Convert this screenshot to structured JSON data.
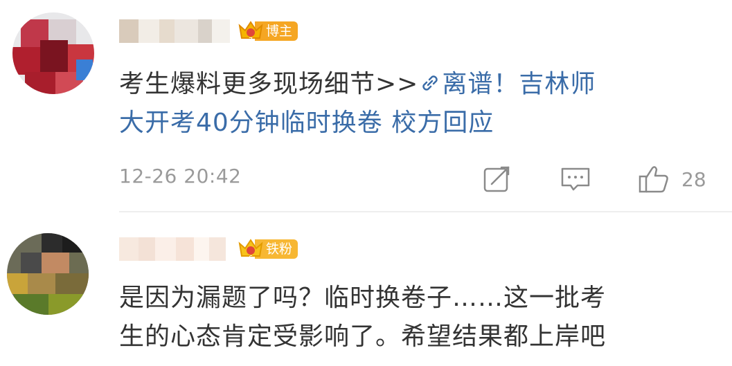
{
  "comments": [
    {
      "badge": "博主",
      "text_plain": "考生爆料更多现场细节>>",
      "link_text_line1": "离谱！吉林师",
      "link_text_line2": "大开考40分钟临时换卷 校方回应",
      "timestamp": "12-26 20:42",
      "likes": "28",
      "icons": [
        "link-icon",
        "repost-icon",
        "comment-icon",
        "like-icon"
      ]
    },
    {
      "badge": "铁粉",
      "text_line1": "是因为漏题了吗？临时换卷子……这一批考",
      "text_line2": "生的心态肯定受影响了。希望结果都上岸吧"
    }
  ],
  "colors": {
    "link": "#3a6ca8",
    "badge_bozhu": "#f5a623",
    "badge_tiefen": "#f7b733",
    "meta": "#9a9a9a"
  }
}
